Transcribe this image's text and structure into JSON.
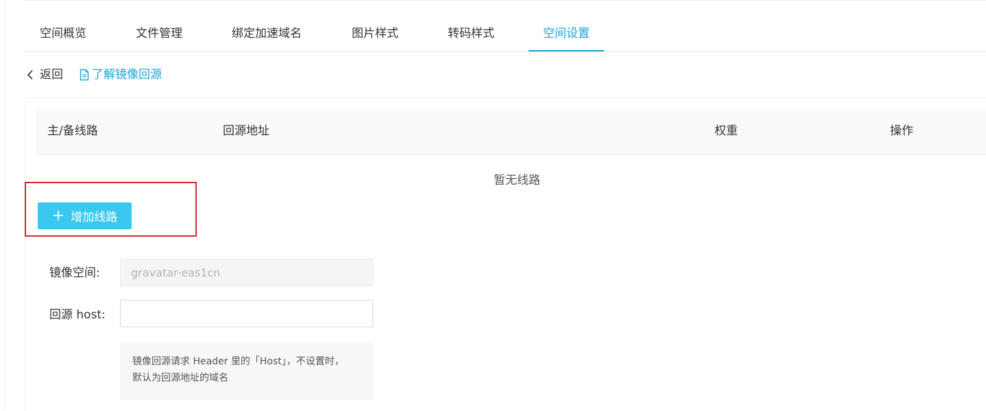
{
  "tabs": [
    {
      "label": "空间概览",
      "active": false
    },
    {
      "label": "文件管理",
      "active": false
    },
    {
      "label": "绑定加速域名",
      "active": false
    },
    {
      "label": "图片样式",
      "active": false
    },
    {
      "label": "转码样式",
      "active": false
    },
    {
      "label": "空间设置",
      "active": true
    }
  ],
  "toolbar": {
    "back_label": "返回",
    "learn_label": "了解镜像回源"
  },
  "table": {
    "columns": [
      "主/备线路",
      "回源地址",
      "权重",
      "操作"
    ],
    "empty_text": "暂无线路"
  },
  "add_route_button": "增加线路",
  "form": {
    "mirror_space_label": "镜像空间:",
    "mirror_space_value": "gravatar-eas1cn",
    "origin_host_label": "回源 host:",
    "origin_host_value": "",
    "hint_line1": "镜像回源请求 Header 里的「Host」，不设置时，",
    "hint_line2": "默认为回源地址的域名"
  },
  "colors": {
    "accent": "#1ba4d9",
    "button": "#3bc8ef",
    "highlight_border": "#d9262c"
  }
}
